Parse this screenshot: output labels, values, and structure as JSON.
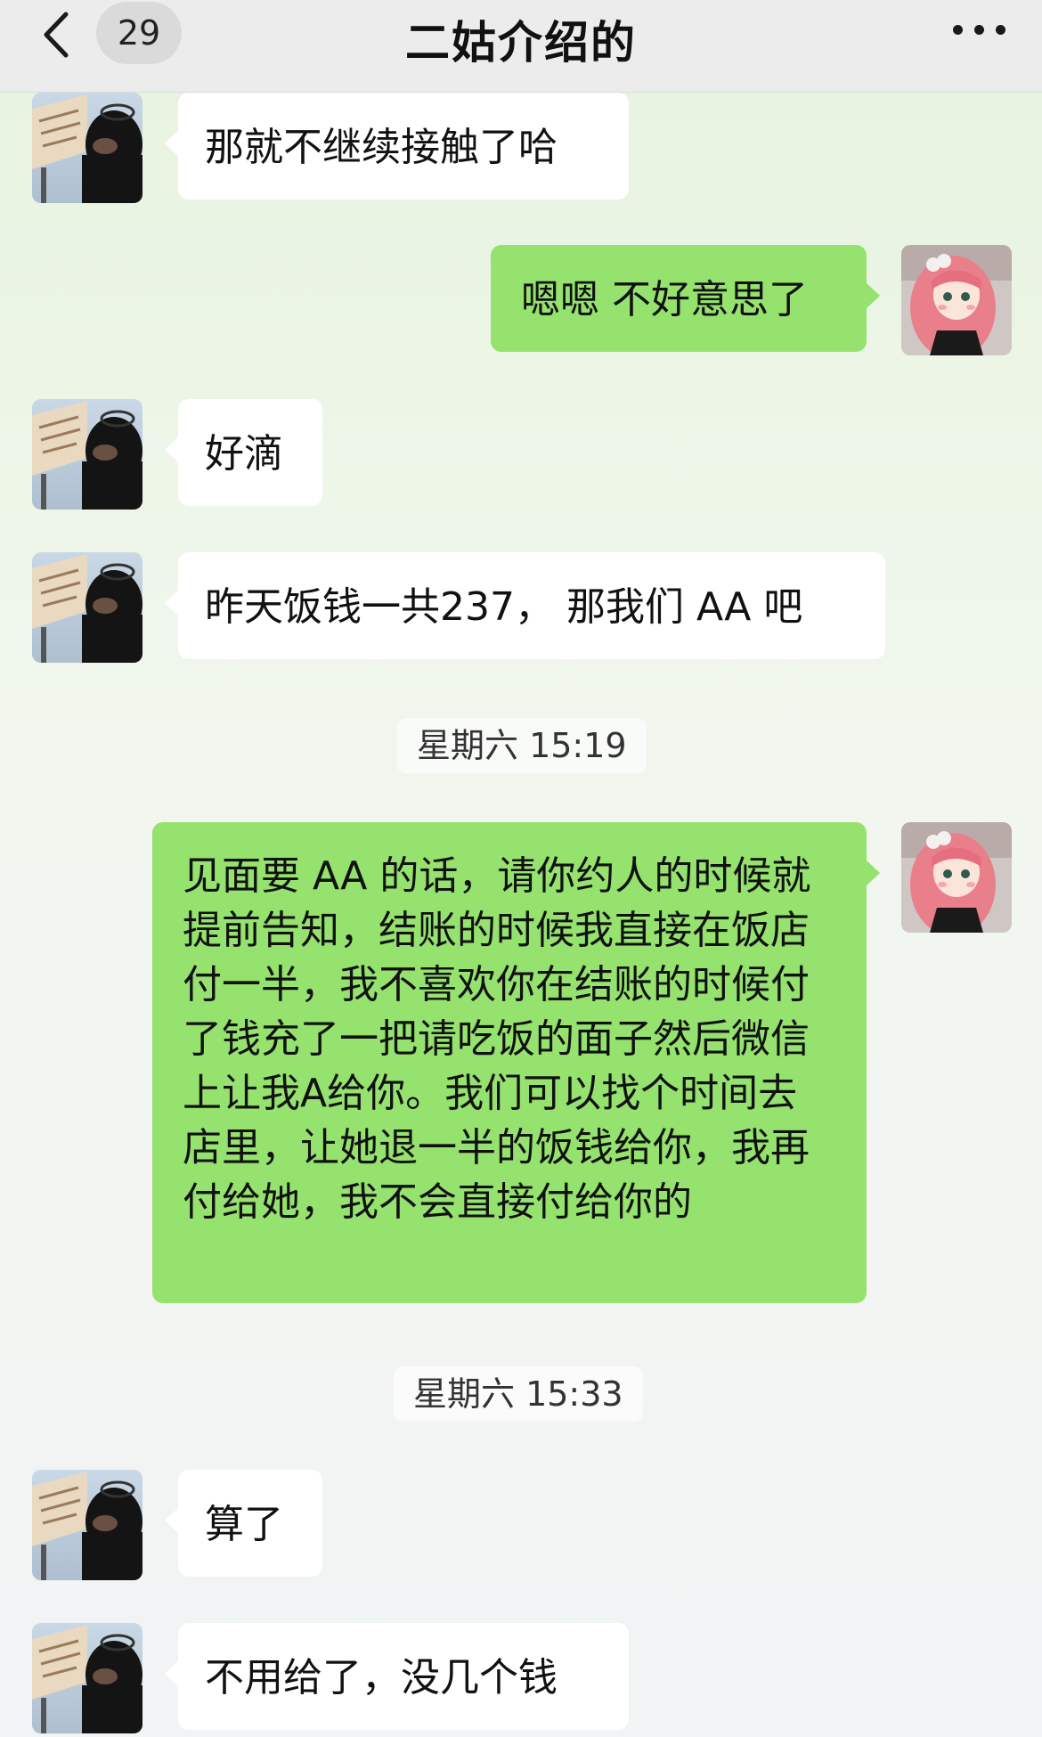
{
  "navbar": {
    "unread_count": "29",
    "title": "二姑介绍的"
  },
  "icons": {
    "back": "chevron-left-icon",
    "more": "ellipsis-icon"
  },
  "colors": {
    "self_bubble": "#95e26e",
    "other_bubble": "#ffffff",
    "navbar_bg": "#ececed"
  },
  "messages": [
    {
      "sender": "other",
      "text": "那就不继续接触了哈"
    },
    {
      "sender": "self",
      "text": "嗯嗯 不好意思了"
    },
    {
      "sender": "other",
      "text": "好滴"
    },
    {
      "sender": "other",
      "text": "昨天饭钱一共237， 那我们 AA 吧"
    },
    {
      "type": "time",
      "text": "星期六 15:19"
    },
    {
      "sender": "self",
      "text": "见面要 AA 的话，请你约人的时候就提前告知，结账的时候我直接在饭店付一半，我不喜欢你在结账的时候付了钱充了一把请吃饭的面子然后微信上让我A给你。我们可以找个时间去店里，让她退一半的饭钱给你，我再付给她，我不会直接付给你的"
    },
    {
      "type": "time",
      "text": "星期六 15:33"
    },
    {
      "sender": "other",
      "text": "算了"
    },
    {
      "sender": "other",
      "text": "不用给了，没几个钱"
    }
  ]
}
